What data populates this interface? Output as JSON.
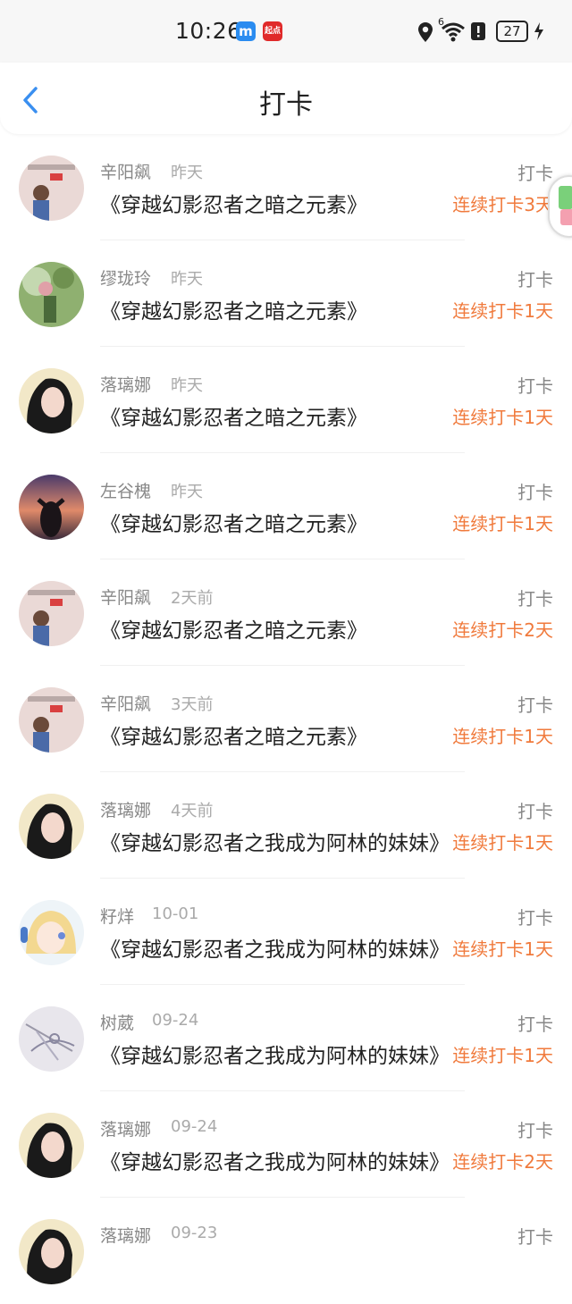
{
  "status_bar": {
    "time": "10:26",
    "app_badges": [
      {
        "icon": "meituan-m-icon",
        "text": "m",
        "color": "#2a8cf0"
      },
      {
        "icon": "qidian-icon",
        "text": "起点",
        "color": "#e02a2a"
      }
    ],
    "battery": "27",
    "network": "6"
  },
  "header": {
    "title": "打卡",
    "back_icon": "chevron-left-icon"
  },
  "colors": {
    "accent": "#f07a3c",
    "back": "#3a8ff0"
  },
  "entries": [
    {
      "user": "辛阳飙",
      "time": "昨天",
      "book": "《穿越幻影忍者之暗之元素》",
      "action": "打卡",
      "streak": "连续打卡3天",
      "avatar": "girl-illustration"
    },
    {
      "user": "缪珑玲",
      "time": "昨天",
      "book": "《穿越幻影忍者之暗之元素》",
      "action": "打卡",
      "streak": "连续打卡1天",
      "avatar": "nature-photo"
    },
    {
      "user": "落璃娜",
      "time": "昨天",
      "book": "《穿越幻影忍者之暗之元素》",
      "action": "打卡",
      "streak": "连续打卡1天",
      "avatar": "woman-portrait"
    },
    {
      "user": "左谷槐",
      "time": "昨天",
      "book": "《穿越幻影忍者之暗之元素》",
      "action": "打卡",
      "streak": "连续打卡1天",
      "avatar": "sunset-silhouette"
    },
    {
      "user": "辛阳飙",
      "time": "2天前",
      "book": "《穿越幻影忍者之暗之元素》",
      "action": "打卡",
      "streak": "连续打卡2天",
      "avatar": "girl-illustration"
    },
    {
      "user": "辛阳飙",
      "time": "3天前",
      "book": "《穿越幻影忍者之暗之元素》",
      "action": "打卡",
      "streak": "连续打卡1天",
      "avatar": "girl-illustration"
    },
    {
      "user": "落璃娜",
      "time": "4天前",
      "book": "《穿越幻影忍者之我成为阿林的妹妹》",
      "action": "打卡",
      "streak": "连续打卡1天",
      "avatar": "woman-portrait"
    },
    {
      "user": "籽烊",
      "time": "10-01",
      "book": "《穿越幻影忍者之我成为阿林的妹妹》",
      "action": "打卡",
      "streak": "连续打卡1天",
      "avatar": "anime-girl"
    },
    {
      "user": "树葳",
      "time": "09-24",
      "book": "《穿越幻影忍者之我成为阿林的妹妹》",
      "action": "打卡",
      "streak": "连续打卡1天",
      "avatar": "sketch"
    },
    {
      "user": "落璃娜",
      "time": "09-24",
      "book": "《穿越幻影忍者之我成为阿林的妹妹》",
      "action": "打卡",
      "streak": "连续打卡2天",
      "avatar": "woman-portrait"
    },
    {
      "user": "落璃娜",
      "time": "09-23",
      "book": "",
      "action": "打卡",
      "streak": "",
      "avatar": "woman-portrait"
    }
  ]
}
